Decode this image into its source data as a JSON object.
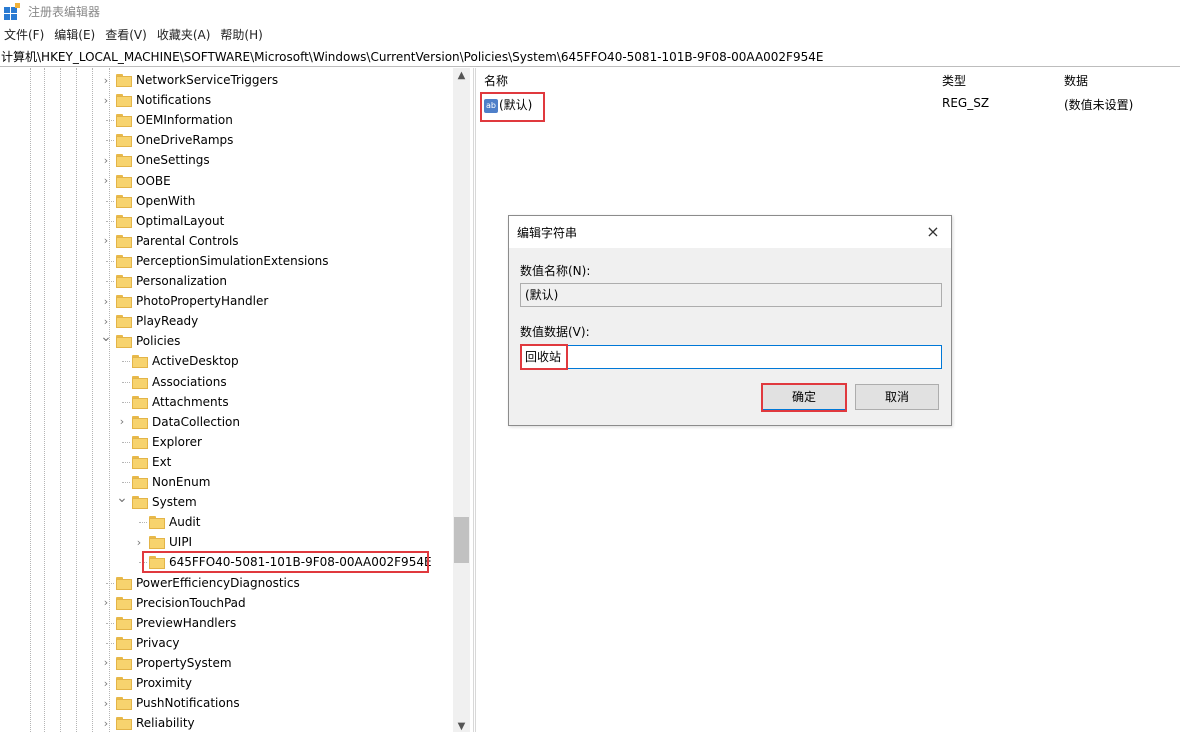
{
  "window": {
    "title": "注册表编辑器"
  },
  "menu": [
    "文件(F)",
    "编辑(E)",
    "查看(V)",
    "收藏夹(A)",
    "帮助(H)"
  ],
  "address": "计算机\\HKEY_LOCAL_MACHINE\\SOFTWARE\\Microsoft\\Windows\\CurrentVersion\\Policies\\System\\645FFO40-5081-101B-9F08-00AA002F954E",
  "tree": [
    {
      "label": "NetworkServiceTriggers",
      "depth": 0,
      "expander": "collapsed"
    },
    {
      "label": "Notifications",
      "depth": 0,
      "expander": "collapsed"
    },
    {
      "label": "OEMInformation",
      "depth": 0,
      "expander": "none"
    },
    {
      "label": "OneDriveRamps",
      "depth": 0,
      "expander": "none"
    },
    {
      "label": "OneSettings",
      "depth": 0,
      "expander": "collapsed"
    },
    {
      "label": "OOBE",
      "depth": 0,
      "expander": "collapsed"
    },
    {
      "label": "OpenWith",
      "depth": 0,
      "expander": "none"
    },
    {
      "label": "OptimalLayout",
      "depth": 0,
      "expander": "none"
    },
    {
      "label": "Parental Controls",
      "depth": 0,
      "expander": "collapsed"
    },
    {
      "label": "PerceptionSimulationExtensions",
      "depth": 0,
      "expander": "none"
    },
    {
      "label": "Personalization",
      "depth": 0,
      "expander": "none"
    },
    {
      "label": "PhotoPropertyHandler",
      "depth": 0,
      "expander": "collapsed"
    },
    {
      "label": "PlayReady",
      "depth": 0,
      "expander": "collapsed"
    },
    {
      "label": "Policies",
      "depth": 0,
      "expander": "expanded"
    },
    {
      "label": "ActiveDesktop",
      "depth": 1,
      "expander": "none"
    },
    {
      "label": "Associations",
      "depth": 1,
      "expander": "none"
    },
    {
      "label": "Attachments",
      "depth": 1,
      "expander": "none"
    },
    {
      "label": "DataCollection",
      "depth": 1,
      "expander": "collapsed"
    },
    {
      "label": "Explorer",
      "depth": 1,
      "expander": "none"
    },
    {
      "label": "Ext",
      "depth": 1,
      "expander": "none"
    },
    {
      "label": "NonEnum",
      "depth": 1,
      "expander": "none"
    },
    {
      "label": "System",
      "depth": 1,
      "expander": "expanded"
    },
    {
      "label": "Audit",
      "depth": 2,
      "expander": "none"
    },
    {
      "label": "UIPI",
      "depth": 2,
      "expander": "collapsed"
    },
    {
      "label": "645FFO40-5081-101B-9F08-00AA002F954E",
      "depth": 2,
      "expander": "none",
      "selected": true
    },
    {
      "label": "PowerEfficiencyDiagnostics",
      "depth": 0,
      "expander": "none"
    },
    {
      "label": "PrecisionTouchPad",
      "depth": 0,
      "expander": "collapsed"
    },
    {
      "label": "PreviewHandlers",
      "depth": 0,
      "expander": "none"
    },
    {
      "label": "Privacy",
      "depth": 0,
      "expander": "none"
    },
    {
      "label": "PropertySystem",
      "depth": 0,
      "expander": "collapsed"
    },
    {
      "label": "Proximity",
      "depth": 0,
      "expander": "collapsed"
    },
    {
      "label": "PushNotifications",
      "depth": 0,
      "expander": "collapsed"
    },
    {
      "label": "Reliability",
      "depth": 0,
      "expander": "collapsed"
    }
  ],
  "list": {
    "columns": {
      "name": "名称",
      "type": "类型",
      "data": "数据"
    },
    "rows": [
      {
        "icon": "string-value-icon",
        "icon_text": "ab",
        "name": "(默认)",
        "type": "REG_SZ",
        "data": "(数值未设置)"
      }
    ]
  },
  "dialog": {
    "title": "编辑字符串",
    "close_glyph": "×",
    "name_label": "数值名称(N):",
    "name_value": "(默认)",
    "data_label": "数值数据(V):",
    "data_value": "回收站",
    "ok": "确定",
    "cancel": "取消"
  },
  "colors": {
    "highlight": "#e0393e",
    "folder": "#f7d36e",
    "accent": "#0078d7"
  }
}
